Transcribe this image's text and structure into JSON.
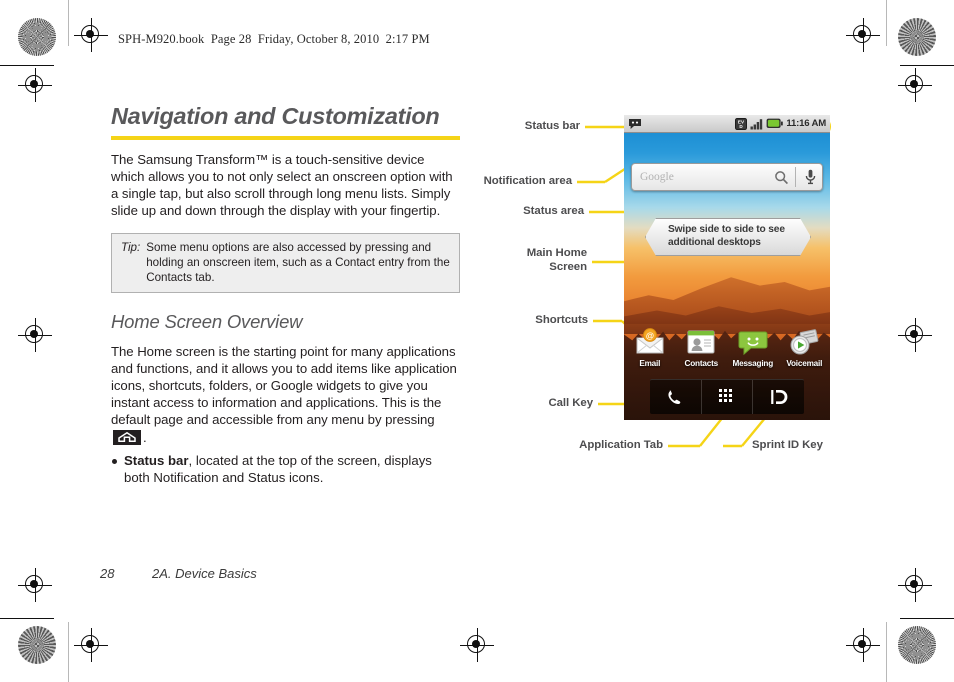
{
  "page": {
    "book_header": "SPH-M920.book  Page 28  Friday, October 8, 2010  2:17 PM",
    "footer_page": "28",
    "footer_section": "2A. Device Basics"
  },
  "accent_colors": {
    "rule_yellow": "#f5d417",
    "title_gray": "#59595b",
    "body_black": "#231f20"
  },
  "article": {
    "title": "Navigation and Customization",
    "intro": "The Samsung Transform™ is a touch-sensitive device which allows you to not only select an onscreen option with a single tap, but also scroll through long menu lists. Simply slide up and down through the display with your fingertip.",
    "tip": {
      "label": "Tip:",
      "text": "Some menu options are also accessed by pressing and holding an onscreen item, such as a Contact entry from the Contacts tab."
    },
    "section_title": "Home Screen Overview",
    "section_body_before_icon": "The Home screen is the starting point for many applications and functions, and it allows you to add items like application icons, shortcuts, folders, or Google widgets to give you instant access to information and applications. This is the default page and accessible from any menu by pressing",
    "section_body_after_icon": ".",
    "bullets": [
      {
        "bold": "Status bar",
        "rest": ", located at the top of the screen, displays both Notification and Status icons."
      }
    ]
  },
  "figure": {
    "callouts": [
      {
        "id": "status-bar",
        "label": "Status bar"
      },
      {
        "id": "notification-area",
        "label": "Notification area"
      },
      {
        "id": "status-area",
        "label": "Status area"
      },
      {
        "id": "main-home-screen",
        "label": "Main Home\nScreen"
      },
      {
        "id": "shortcuts",
        "label": "Shortcuts"
      },
      {
        "id": "call-key",
        "label": "Call Key"
      },
      {
        "id": "application-tab",
        "label": "Application Tab"
      },
      {
        "id": "sprint-id-key",
        "label": "Sprint ID Key"
      }
    ],
    "phone": {
      "status_bar": {
        "notification_icons": [
          "message-icon"
        ],
        "status_icons": [
          "evdo-icon",
          "signal-bars-icon",
          "battery-icon"
        ],
        "time": "11:16 AM"
      },
      "search_widget": {
        "placeholder": "Google",
        "icons": [
          "search-icon",
          "microphone-icon"
        ]
      },
      "tooltip": "Swipe side to side to see additional desktops",
      "shortcuts": [
        {
          "label": "Email",
          "icon": "email-icon"
        },
        {
          "label": "Contacts",
          "icon": "contacts-icon"
        },
        {
          "label": "Messaging",
          "icon": "messaging-icon"
        },
        {
          "label": "Voicemail",
          "icon": "voicemail-icon"
        }
      ],
      "dock": [
        {
          "name": "call-key",
          "icon": "phone-handset-icon"
        },
        {
          "name": "application-tab",
          "icon": "app-grid-icon"
        },
        {
          "name": "sprint-id-key",
          "icon": "sprint-id-icon"
        }
      ]
    }
  }
}
